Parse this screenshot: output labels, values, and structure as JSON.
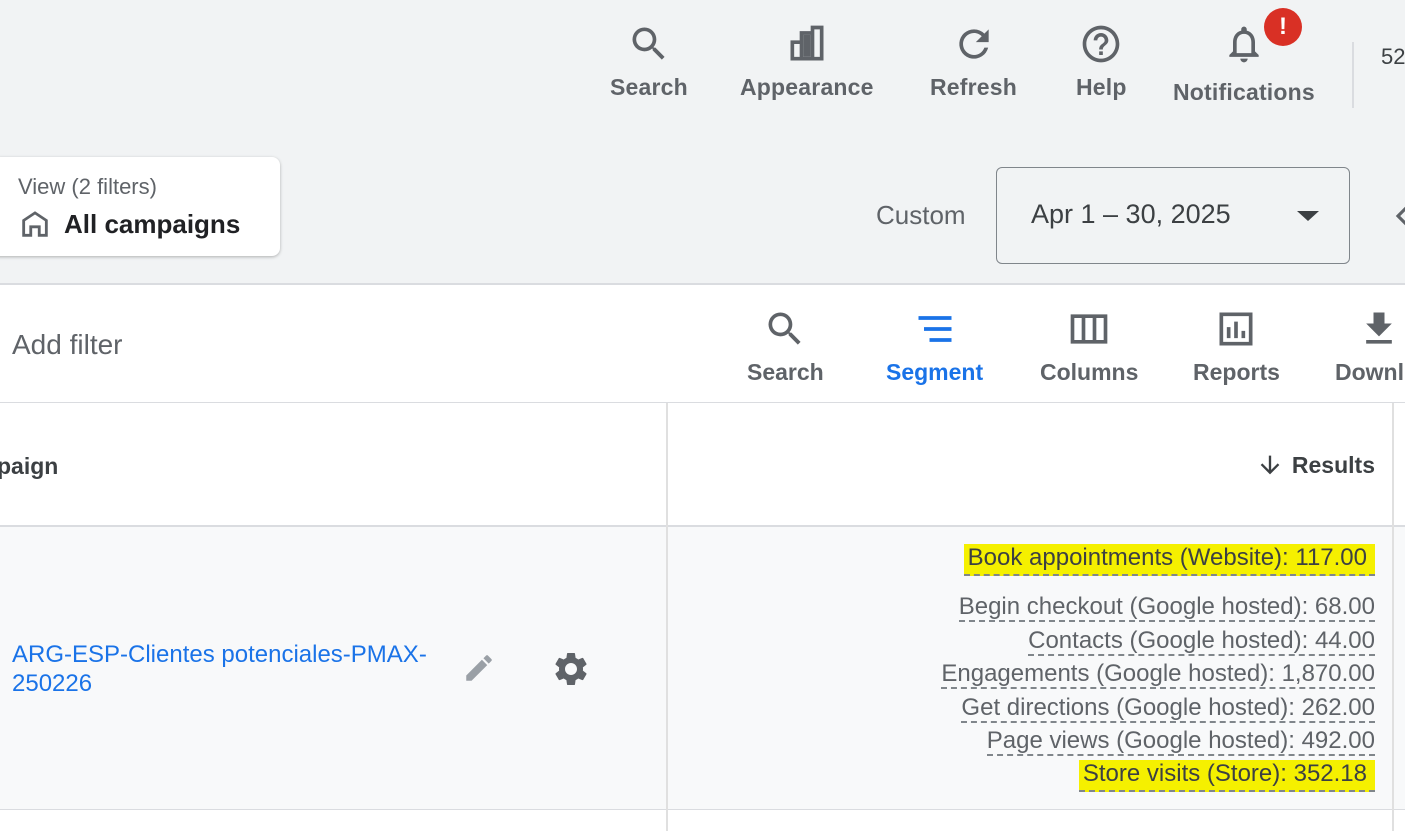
{
  "topbar": {
    "buttons": [
      {
        "label": "Search",
        "icon": "search-icon"
      },
      {
        "label": "Appearance",
        "icon": "appearance-icon"
      },
      {
        "label": "Refresh",
        "icon": "refresh-icon"
      },
      {
        "label": "Help",
        "icon": "help-icon"
      },
      {
        "label": "Notifications",
        "icon": "bell-icon",
        "badge": "!"
      }
    ],
    "account_partial": "52"
  },
  "view": {
    "subtitle": "View (2 filters)",
    "title": "All campaigns"
  },
  "date": {
    "preset": "Custom",
    "range": "Apr 1 – 30, 2025"
  },
  "toolbar": {
    "add_filter": "Add filter",
    "buttons": [
      {
        "label": "Search",
        "icon": "search-icon"
      },
      {
        "label": "Segment",
        "icon": "segment-icon",
        "active": true
      },
      {
        "label": "Columns",
        "icon": "columns-icon"
      },
      {
        "label": "Reports",
        "icon": "reports-icon"
      },
      {
        "label": "Downl",
        "icon": "download-icon"
      }
    ]
  },
  "table": {
    "headers": {
      "campaign": "paign",
      "results": "Results"
    },
    "rows": [
      {
        "campaign": "ARG-ESP-Clientes potenciales-PMAX-250226",
        "results": [
          "Book appointments (Website): 117.00",
          "Begin checkout (Google hosted): 68.00",
          "Contacts (Google hosted): 44.00",
          "Engagements (Google hosted): 1,870.00",
          "Get directions (Google hosted): 262.00",
          "Page views (Google hosted): 492.00",
          "Store visits (Store): 352.18"
        ]
      }
    ]
  },
  "colors": {
    "accent": "#1a73e8",
    "highlight": "#f5f000",
    "alert": "#d93025"
  }
}
